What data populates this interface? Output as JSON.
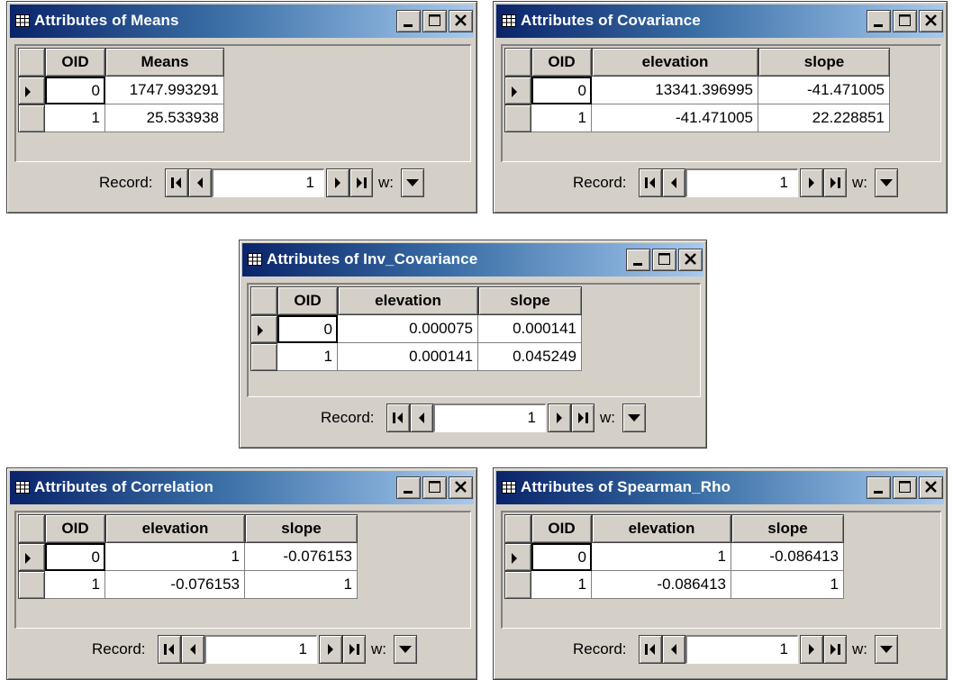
{
  "windows": [
    {
      "title": "Attributes of Means",
      "columns": [
        "OID",
        "Means"
      ],
      "rows": [
        {
          "OID": "0",
          "Means": "1747.993291"
        },
        {
          "OID": "1",
          "Means": "25.533938"
        }
      ],
      "record_label": "Record:",
      "record_value": "1",
      "show_label": "w:"
    },
    {
      "title": "Attributes of Covariance",
      "columns": [
        "OID",
        "elevation",
        "slope"
      ],
      "rows": [
        {
          "OID": "0",
          "elevation": "13341.396995",
          "slope": "-41.471005"
        },
        {
          "OID": "1",
          "elevation": "-41.471005",
          "slope": "22.228851"
        }
      ],
      "record_label": "Record:",
      "record_value": "1",
      "show_label": "w:"
    },
    {
      "title": "Attributes of Inv_Covariance",
      "columns": [
        "OID",
        "elevation",
        "slope"
      ],
      "rows": [
        {
          "OID": "0",
          "elevation": "0.000075",
          "slope": "0.000141"
        },
        {
          "OID": "1",
          "elevation": "0.000141",
          "slope": "0.045249"
        }
      ],
      "record_label": "Record:",
      "record_value": "1",
      "show_label": "w:"
    },
    {
      "title": "Attributes of Correlation",
      "columns": [
        "OID",
        "elevation",
        "slope"
      ],
      "rows": [
        {
          "OID": "0",
          "elevation": "1",
          "slope": "-0.076153"
        },
        {
          "OID": "1",
          "elevation": "-0.076153",
          "slope": "1"
        }
      ],
      "record_label": "Record:",
      "record_value": "1",
      "show_label": "w:"
    },
    {
      "title": "Attributes of Spearman_Rho",
      "columns": [
        "OID",
        "elevation",
        "slope"
      ],
      "rows": [
        {
          "OID": "0",
          "elevation": "1",
          "slope": "-0.086413"
        },
        {
          "OID": "1",
          "elevation": "-0.086413",
          "slope": "1"
        }
      ],
      "record_label": "Record:",
      "record_value": "1",
      "show_label": "w:"
    }
  ],
  "icons": {
    "title": "table-icon",
    "minimize": "minimize-icon",
    "maximize": "maximize-icon",
    "close": "close-icon",
    "first": "first-record-icon",
    "prev": "previous-record-icon",
    "next": "next-record-icon",
    "last": "last-record-icon",
    "dropdown": "dropdown-arrow-icon",
    "row_pointer": "current-row-pointer-icon"
  },
  "colors": {
    "titlebar_start": "#0a246a",
    "titlebar_end": "#a6caf0",
    "face": "#d4d0c8"
  }
}
